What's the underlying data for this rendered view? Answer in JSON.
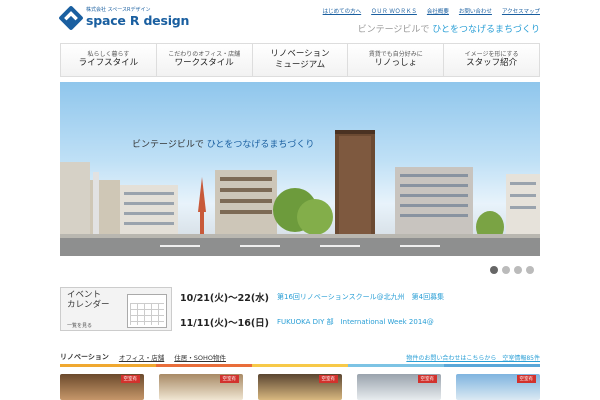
{
  "header": {
    "company_small": "株式会社 スペースRデザイン",
    "logo_name": "space R design",
    "top_links": [
      "はじめての方へ",
      "ＯＵＲ ＷＯＲＫＳ",
      "会社概要",
      "お問い合わせ",
      "アクセスマップ"
    ],
    "tagline_a": "ビンテージビルで ",
    "tagline_b": "ひとをつなげるまちづくり"
  },
  "nav": [
    {
      "sub": "私らしく暮らす",
      "main": "ライフスタイル"
    },
    {
      "sub": "こだわりのオフィス・店舗",
      "main": "ワークスタイル"
    },
    {
      "sub": "",
      "main": "リノベーション\nミュージアム"
    },
    {
      "sub": "賃貸でも自分好みに",
      "main": "リノっしょ"
    },
    {
      "sub": "イメージを形にする",
      "main": "スタッフ紹介"
    }
  ],
  "hero": {
    "caption_a": "ビンテージビルで ",
    "caption_b": "ひとをつなげるまちづくり",
    "slide_count": 4,
    "active_slide": 1
  },
  "events": {
    "badge_title": "イベント\nカレンダー",
    "badge_more": "一覧を見る",
    "items": [
      {
        "date": "10/21(火)～22(水)",
        "text": "第16回リノベーションスクール@北九州　第4回募集"
      },
      {
        "date": "11/11(火)～16(日)",
        "text": "FUKUOKA DIY 部　International Week 2014@"
      }
    ]
  },
  "section": {
    "title": "リノベーション",
    "tabs": [
      "オフィス・店舗",
      "住居・SOHO物件"
    ],
    "right_link": "物件のお問い合わせはこちらから　空室情報85件",
    "thumb_tag": "空室有"
  },
  "colors": {
    "brand": "#1a5fa0",
    "accent": "#2a9fd6",
    "tag_red": "#d2322d"
  }
}
